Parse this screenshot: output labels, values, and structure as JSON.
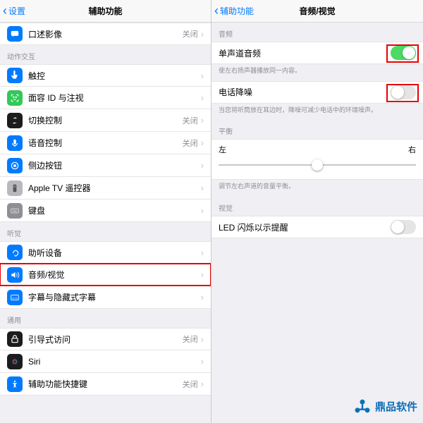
{
  "left": {
    "nav": {
      "back": "设置",
      "title": "辅助功能"
    },
    "topRow": {
      "label": "口述影像",
      "value": "关闭"
    },
    "sections": [
      {
        "header": "动作交互",
        "rows": [
          {
            "label": "触控",
            "value": "",
            "iconClass": "ic-blue"
          },
          {
            "label": "面容 ID 与注视",
            "value": "",
            "iconClass": "ic-green"
          },
          {
            "label": "切换控制",
            "value": "关闭",
            "iconClass": "ic-black"
          },
          {
            "label": "语音控制",
            "value": "关闭",
            "iconClass": "ic-blue"
          },
          {
            "label": "侧边按钮",
            "value": "",
            "iconClass": "ic-blue"
          },
          {
            "label": "Apple TV 遥控器",
            "value": "",
            "iconClass": "ic-grayl"
          },
          {
            "label": "键盘",
            "value": "",
            "iconClass": "ic-gray"
          }
        ]
      },
      {
        "header": "听觉",
        "rows": [
          {
            "label": "助听设备",
            "value": "",
            "iconClass": "ic-blue"
          },
          {
            "label": "音频/视觉",
            "value": "",
            "iconClass": "ic-blue",
            "highlight": true
          },
          {
            "label": "字幕与隐藏式字幕",
            "value": "",
            "iconClass": "ic-blue"
          }
        ]
      },
      {
        "header": "通用",
        "rows": [
          {
            "label": "引导式访问",
            "value": "关闭",
            "iconClass": "ic-black"
          },
          {
            "label": "Siri",
            "value": "",
            "iconClass": "ic-black"
          },
          {
            "label": "辅助功能快捷键",
            "value": "关闭",
            "iconClass": "ic-blue"
          }
        ]
      }
    ]
  },
  "right": {
    "nav": {
      "back": "辅助功能",
      "title": "音频/视觉"
    },
    "audioHeader": "音频",
    "mono": {
      "label": "单声道音频",
      "footer": "使左右扬声器播放同一内容。"
    },
    "noise": {
      "label": "电话降噪",
      "footer": "当您将听筒放在耳边时，降噪可减少电话中的环境噪声。"
    },
    "balance": {
      "header": "平衡",
      "left": "左",
      "right": "右",
      "footer": "调节左右声道的音量平衡。"
    },
    "visualHeader": "视觉",
    "led": {
      "label": "LED 闪烁以示提醒"
    }
  },
  "watermark": "鼎品软件"
}
